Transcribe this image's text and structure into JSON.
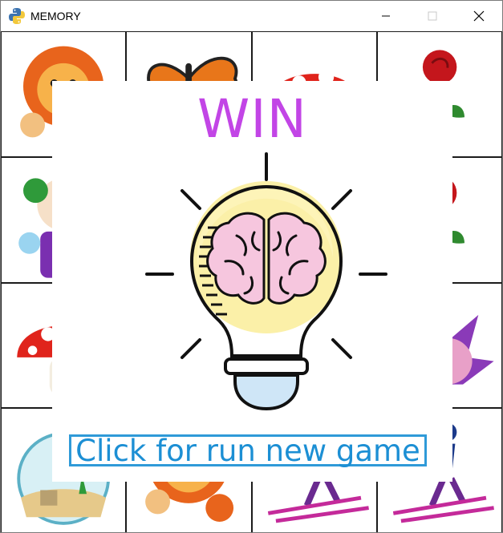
{
  "window": {
    "title": "MEMORY",
    "icon": "python-icon",
    "controls": [
      "minimize-icon",
      "maximize-icon",
      "close-icon"
    ]
  },
  "board": {
    "rows": 4,
    "cols": 4,
    "cards": [
      {
        "picture": "lion"
      },
      {
        "picture": "butterfly"
      },
      {
        "picture": "mushroom"
      },
      {
        "picture": "rose"
      },
      {
        "picture": "clown"
      },
      {
        "picture": "hidden"
      },
      {
        "picture": "hidden"
      },
      {
        "picture": "rose"
      },
      {
        "picture": "mushroom"
      },
      {
        "picture": "hidden"
      },
      {
        "picture": "hidden"
      },
      {
        "picture": "hedgehog"
      },
      {
        "picture": "fishbowl"
      },
      {
        "picture": "lion"
      },
      {
        "picture": "skier"
      },
      {
        "picture": "skier"
      }
    ]
  },
  "result": {
    "title": "WIN",
    "icon": "lightbulb-brain-icon",
    "button_label": "Click for run new game",
    "colors": {
      "title": "#c245e6",
      "button": "#1c8fd4"
    }
  }
}
